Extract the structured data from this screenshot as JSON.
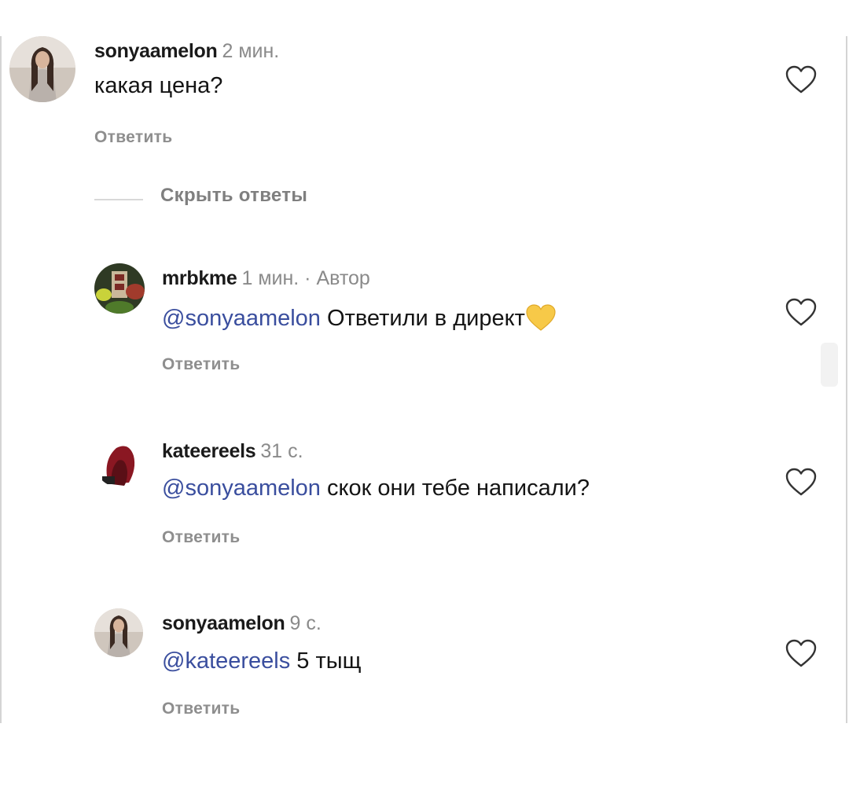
{
  "comments": [
    {
      "username": "sonyaamelon",
      "time": "2 мин.",
      "author_tag": "",
      "mention": "",
      "text": "какая цена?",
      "reply_label": "Ответить",
      "avatar": "woman-photo-icon"
    },
    {
      "username": "mrbkme",
      "time": "1 мин. · Автор",
      "mention": "@sonyaamelon",
      "text": " Ответили в директ",
      "emoji": "yellow-heart-icon",
      "reply_label": "Ответить",
      "avatar": "store-logo-icon"
    },
    {
      "username": "kateereels",
      "time": "31 с.",
      "mention": "@sonyaamelon",
      "text": " скок они тебе написали?",
      "reply_label": "Ответить",
      "avatar": "red-hair-photo-icon"
    },
    {
      "username": "sonyaamelon",
      "time": "9 с.",
      "mention": "@kateereels",
      "text": " 5 тыщ",
      "reply_label": "Ответить",
      "avatar": "woman-photo-icon"
    }
  ],
  "hide_replies_label": "Скрыть ответы",
  "colors": {
    "mention": "#3a4e9e",
    "secondary_text": "#8e8e8e",
    "emoji_heart": "#f7c948"
  }
}
